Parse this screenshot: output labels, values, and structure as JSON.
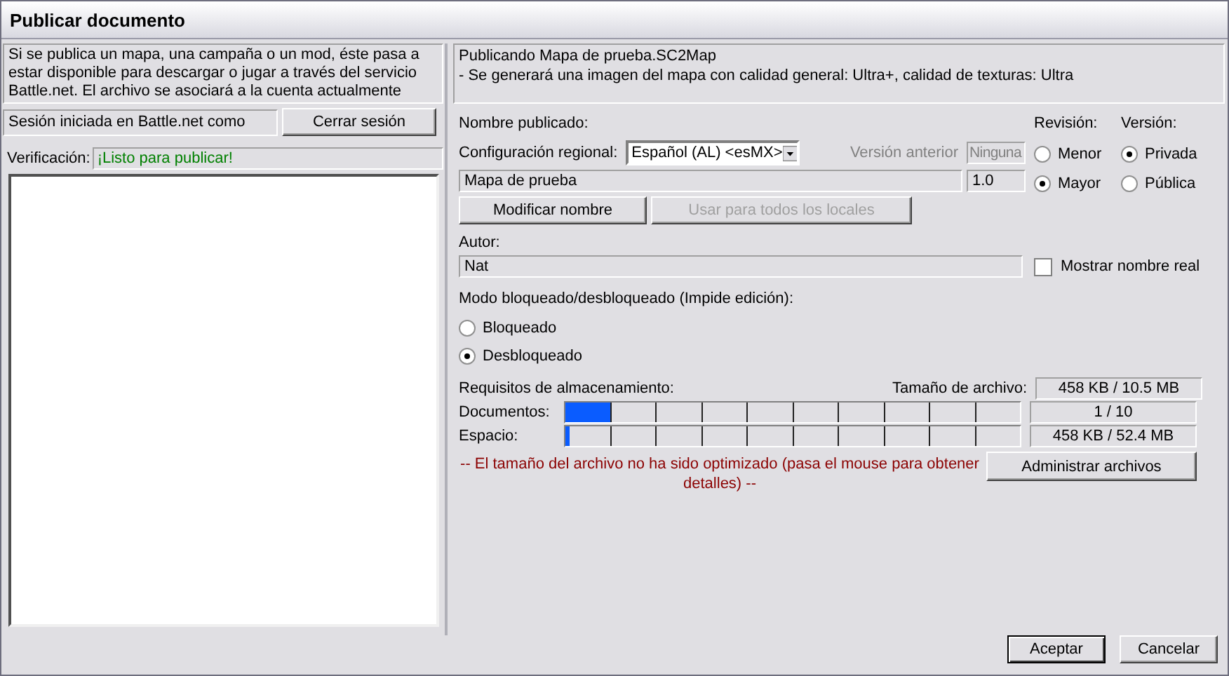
{
  "window": {
    "title": "Publicar documento"
  },
  "intro": "Si se publica un mapa, una campaña o un mod, éste pasa a estar disponible para descargar o jugar a través del servicio Battle.net. El archivo se asociará a la cuenta actualmente",
  "session": {
    "label": "Sesión iniciada en Battle.net como",
    "button": "Cerrar sesión"
  },
  "verification": {
    "label": "Verificación:",
    "status": "¡Listo para publicar!"
  },
  "publishing": [
    "Publicando Mapa de prueba.SC2Map",
    "- Se generará una imagen del mapa con calidad general: Ultra+, calidad de texturas: Ultra"
  ],
  "published_name": {
    "label": "Nombre publicado:",
    "locale_label": "Configuración regional:",
    "locale": "Español (AL) <esMX>",
    "previous_version_label": "Versión anterior",
    "previous_version": "Ninguna",
    "name": "Mapa de prueba",
    "version": "1.0",
    "buttons": [
      {
        "label": "Modificar nombre",
        "disabled": false
      },
      {
        "label": "Usar para todos los locales",
        "disabled": true
      }
    ]
  },
  "radio_groups": [
    {
      "label": "Revisión:",
      "options": [
        {
          "label": "Menor",
          "selected": false
        },
        {
          "label": "Mayor",
          "selected": true
        }
      ]
    },
    {
      "label": "Versión:",
      "options": [
        {
          "label": "Privada",
          "selected": true
        },
        {
          "label": "Pública",
          "selected": false
        }
      ]
    }
  ],
  "author": {
    "label": "Autor:",
    "value": "Nat",
    "show_real_name": {
      "label": "Mostrar nombre real",
      "checked": false
    }
  },
  "lock_mode": {
    "label": "Modo bloqueado/desbloqueado (Impide edición):",
    "options": [
      {
        "label": "Bloqueado",
        "selected": false
      },
      {
        "label": "Desbloqueado",
        "selected": true
      }
    ]
  },
  "storage": {
    "label": "Requisitos de almacenamiento:",
    "file_size_label": "Tamaño de archivo:",
    "file_size": "458 KB / 10.5 MB",
    "meters": [
      {
        "name": "Documentos:",
        "level": 0.1,
        "reading": "1 / 10"
      },
      {
        "name": "Espacio:",
        "level": 0.01,
        "reading": "458 KB / 52.4 MB"
      }
    ],
    "warning": "-- El tamaño del archivo no ha sido optimizado (pasa el mouse para obtener detalles) --",
    "manage_button": "Administrar archivos"
  },
  "buttons": [
    "Aceptar",
    "Cancelar"
  ]
}
